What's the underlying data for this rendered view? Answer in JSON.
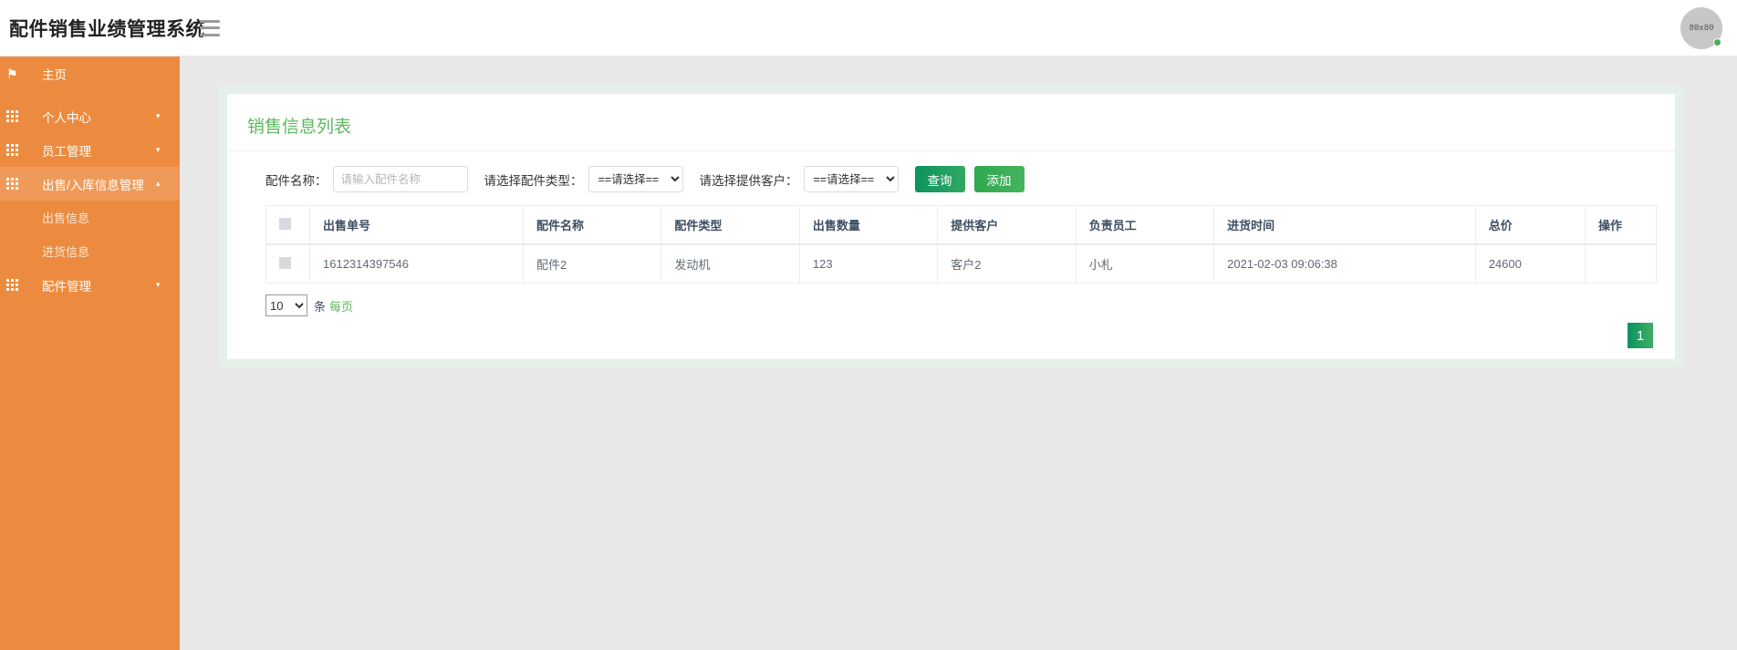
{
  "header": {
    "title": "配件销售业绩管理系统",
    "menu_icon": "hamburger-icon",
    "avatar_label": "80x80"
  },
  "sidebar": {
    "items": [
      {
        "label": "主页",
        "icon": "flag-icon",
        "has_caret": false,
        "active": false
      },
      {
        "label": "个人中心",
        "icon": "grid-icon",
        "has_caret": true,
        "active": false
      },
      {
        "label": "员工管理",
        "icon": "grid-icon",
        "has_caret": true,
        "active": false
      },
      {
        "label": "出售/入库信息管理",
        "icon": "grid-icon",
        "has_caret": true,
        "active": true
      },
      {
        "label": "配件管理",
        "icon": "grid-icon",
        "has_caret": true,
        "active": false
      }
    ],
    "submenu": [
      {
        "label": "出售信息"
      },
      {
        "label": "进货信息"
      }
    ],
    "caret_down": "▾",
    "caret_up": "▴"
  },
  "main": {
    "card_title": "销售信息列表",
    "filters": {
      "name_label": "配件名称：",
      "name_placeholder": "请输入配件名称",
      "name_value": "",
      "type_label": "请选择配件类型：",
      "type_selected": "==请选择==",
      "customer_label": "请选择提供客户：",
      "customer_selected": "==请选择==",
      "query_button": "查询",
      "add_button": "添加"
    },
    "table": {
      "columns": [
        "出售单号",
        "配件名称",
        "配件类型",
        "出售数量",
        "提供客户",
        "负责员工",
        "进货时间",
        "总价",
        "操作"
      ],
      "rows": [
        {
          "order_no": "1612314397546",
          "part_name": "配件2",
          "part_type": "发动机",
          "quantity": "123",
          "customer": "客户2",
          "employee": "小札",
          "time": "2021-02-03 09:06:38",
          "total": "24600",
          "operation": ""
        }
      ]
    },
    "pager": {
      "page_size": "10",
      "unit_text": "条",
      "per_page_text": "每页",
      "current_page": "1"
    }
  },
  "colors": {
    "sidebar": "#ec8b3f",
    "sidebar_active": "#ef9a58",
    "accent_green": "#5cb85c",
    "query_green": "#0b9360",
    "content_bg": "#e8e8e8",
    "panel_bg": "#e4f0e9"
  }
}
